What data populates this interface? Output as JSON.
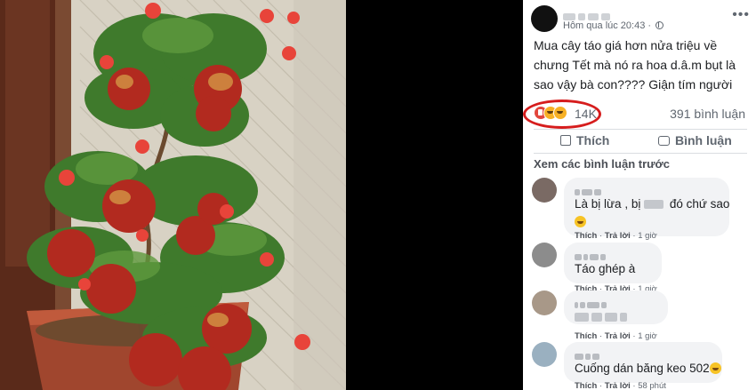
{
  "post": {
    "timestamp": "Hôm qua lúc 20:43 · ",
    "text": "Mua cây táo giá hơn nửa triệu về chưng Tết mà nó ra hoa d.â.m bụt là sao vậy bà con???? Giận tím người",
    "reaction_count": "14K",
    "comment_count": "391 bình luận",
    "icons": {
      "privacy": "globe-icon",
      "more": "more-options-icon",
      "reactions": [
        "love-icon",
        "haha-icon",
        "sad-icon"
      ]
    }
  },
  "actions": {
    "like_label": "Thích",
    "comment_label": "Bình luận"
  },
  "comments_section": {
    "view_previous": "Xem các bình luận trước",
    "comments": [
      {
        "text_before": "Là bị lừa , bị ",
        "text_after": " đó chứ sao",
        "like": "Thích",
        "reply": "Trả lời",
        "time": "1 giờ"
      },
      {
        "text": "Táo ghép à",
        "like": "Thích",
        "reply": "Trả lời",
        "time": "1 giờ"
      },
      {
        "text": "",
        "like": "Thích",
        "reply": "Trả lời",
        "time": "1 giờ"
      },
      {
        "text": "Cuống dán băng keo 502",
        "like": "Thích",
        "reply": "Trả lời",
        "time": "58 phút"
      }
    ]
  },
  "colors": {
    "highlight_circle": "#d61d1d",
    "bubble_bg": "#f2f3f5",
    "muted_text": "#606770",
    "photo_wall": "#d9d3c6",
    "apple_red": "#b22a1f",
    "hibiscus": "#e8443a"
  }
}
